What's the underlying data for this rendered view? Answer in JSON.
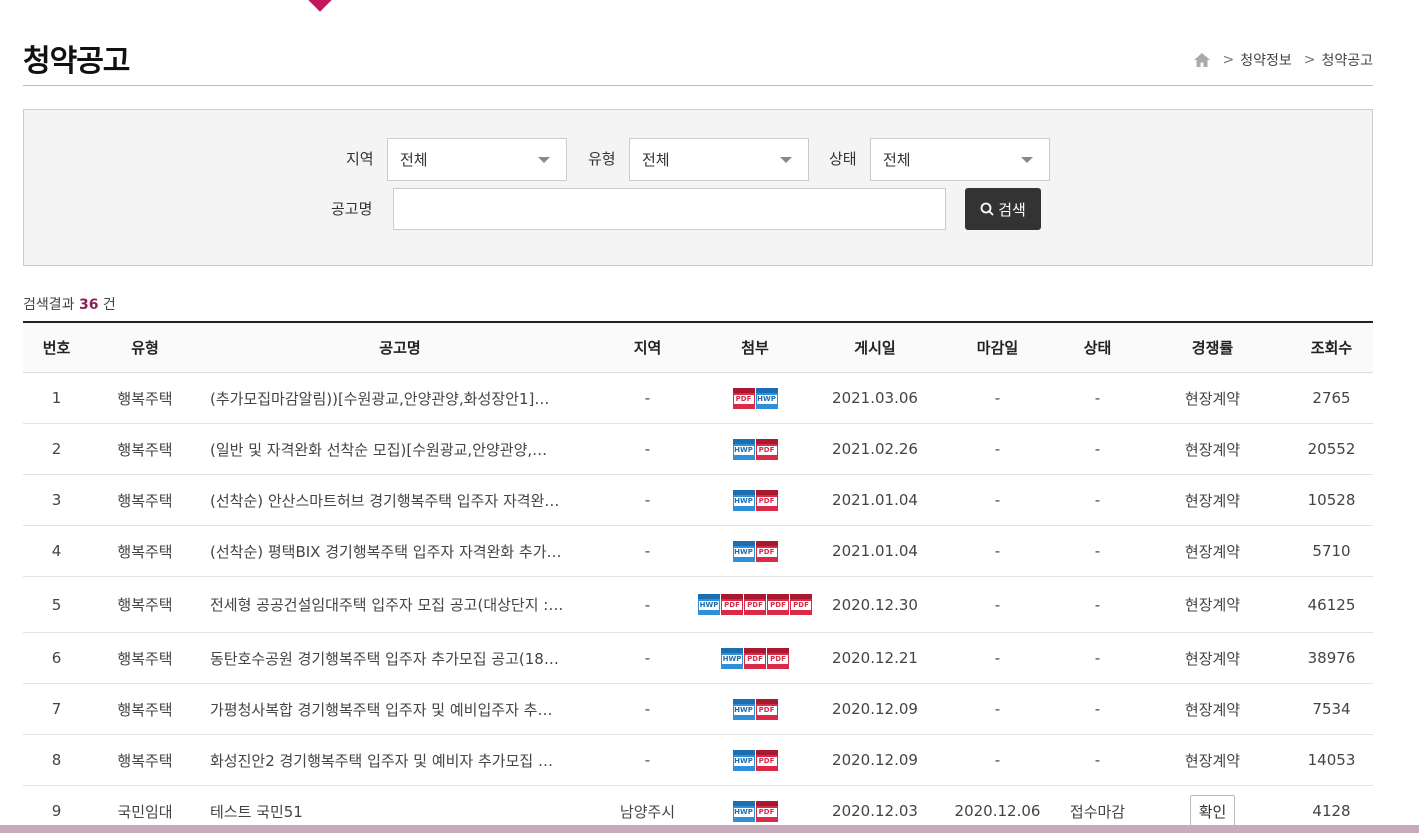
{
  "page": {
    "title": "청약공고"
  },
  "breadcrumb": {
    "items": [
      "청약정보",
      "청약공고"
    ]
  },
  "search": {
    "region_label": "지역",
    "region_value": "전체",
    "type_label": "유형",
    "type_value": "전체",
    "status_label": "상태",
    "status_value": "전체",
    "name_label": "공고명",
    "name_value": "",
    "button_label": "검색"
  },
  "results": {
    "prefix": "검색결과",
    "count": "36",
    "suffix": "건"
  },
  "table": {
    "headers": {
      "num": "번호",
      "type": "유형",
      "title": "공고명",
      "region": "지역",
      "attach": "첨부",
      "posted": "게시일",
      "deadline": "마감일",
      "status": "상태",
      "competition": "경쟁률",
      "views": "조회수"
    },
    "rows": [
      {
        "num": "1",
        "type": "행복주택",
        "title": "(추가모집마감알림))[수원광교,안양관양,화성장안1]…",
        "region": "-",
        "files": [
          "pdf",
          "hwp"
        ],
        "posted": "2021.03.06",
        "deadline": "-",
        "status": "-",
        "competition": "현장계약",
        "views": "2765"
      },
      {
        "num": "2",
        "type": "행복주택",
        "title": "(일반 및 자격완화 선착순 모집)[수원광교,안양관양,…",
        "region": "-",
        "files": [
          "hwp",
          "pdf"
        ],
        "posted": "2021.02.26",
        "deadline": "-",
        "status": "-",
        "competition": "현장계약",
        "views": "20552"
      },
      {
        "num": "3",
        "type": "행복주택",
        "title": "(선착순) 안산스마트허브 경기행복주택 입주자 자격완…",
        "region": "-",
        "files": [
          "hwp",
          "pdf"
        ],
        "posted": "2021.01.04",
        "deadline": "-",
        "status": "-",
        "competition": "현장계약",
        "views": "10528"
      },
      {
        "num": "4",
        "type": "행복주택",
        "title": "(선착순) 평택BIX 경기행복주택 입주자 자격완화 추가…",
        "region": "-",
        "files": [
          "hwp",
          "pdf"
        ],
        "posted": "2021.01.04",
        "deadline": "-",
        "status": "-",
        "competition": "현장계약",
        "views": "5710"
      },
      {
        "num": "5",
        "type": "행복주택",
        "title": "전세형 공공건설임대주택 입주자 모집 공고(대상단지 :…",
        "region": "-",
        "files": [
          "hwp",
          "pdf",
          "pdf",
          "pdf",
          "pdf"
        ],
        "posted": "2020.12.30",
        "deadline": "-",
        "status": "-",
        "competition": "현장계약",
        "views": "46125"
      },
      {
        "num": "6",
        "type": "행복주택",
        "title": "동탄호수공원 경기행복주택 입주자 추가모집 공고(18…",
        "region": "-",
        "files": [
          "hwp",
          "pdf",
          "pdf"
        ],
        "posted": "2020.12.21",
        "deadline": "-",
        "status": "-",
        "competition": "현장계약",
        "views": "38976"
      },
      {
        "num": "7",
        "type": "행복주택",
        "title": "가평청사복합 경기행복주택 입주자 및 예비입주자 추…",
        "region": "-",
        "files": [
          "hwp",
          "pdf"
        ],
        "posted": "2020.12.09",
        "deadline": "-",
        "status": "-",
        "competition": "현장계약",
        "views": "7534"
      },
      {
        "num": "8",
        "type": "행복주택",
        "title": "화성진안2 경기행복주택 입주자 및 예비자 추가모집 …",
        "region": "-",
        "files": [
          "hwp",
          "pdf"
        ],
        "posted": "2020.12.09",
        "deadline": "-",
        "status": "-",
        "competition": "현장계약",
        "views": "14053"
      },
      {
        "num": "9",
        "type": "국민임대",
        "title": "테스트 국민51",
        "region": "남양주시",
        "files": [
          "hwp",
          "pdf"
        ],
        "posted": "2020.12.03",
        "deadline": "2020.12.06",
        "status": "접수마감",
        "competition": "확인",
        "views": "4128"
      }
    ]
  },
  "file_icon_labels": {
    "pdf": "PDF",
    "hwp": "HWP"
  },
  "colors": {
    "accent": "#8e1f5e",
    "pdf": "#d92b47",
    "hwp": "#2f8fd8",
    "search_button": "#333333"
  },
  "icons": [
    "home-icon",
    "search-icon",
    "chevron-down-icon",
    "pdf-file-icon",
    "hwp-file-icon"
  ]
}
